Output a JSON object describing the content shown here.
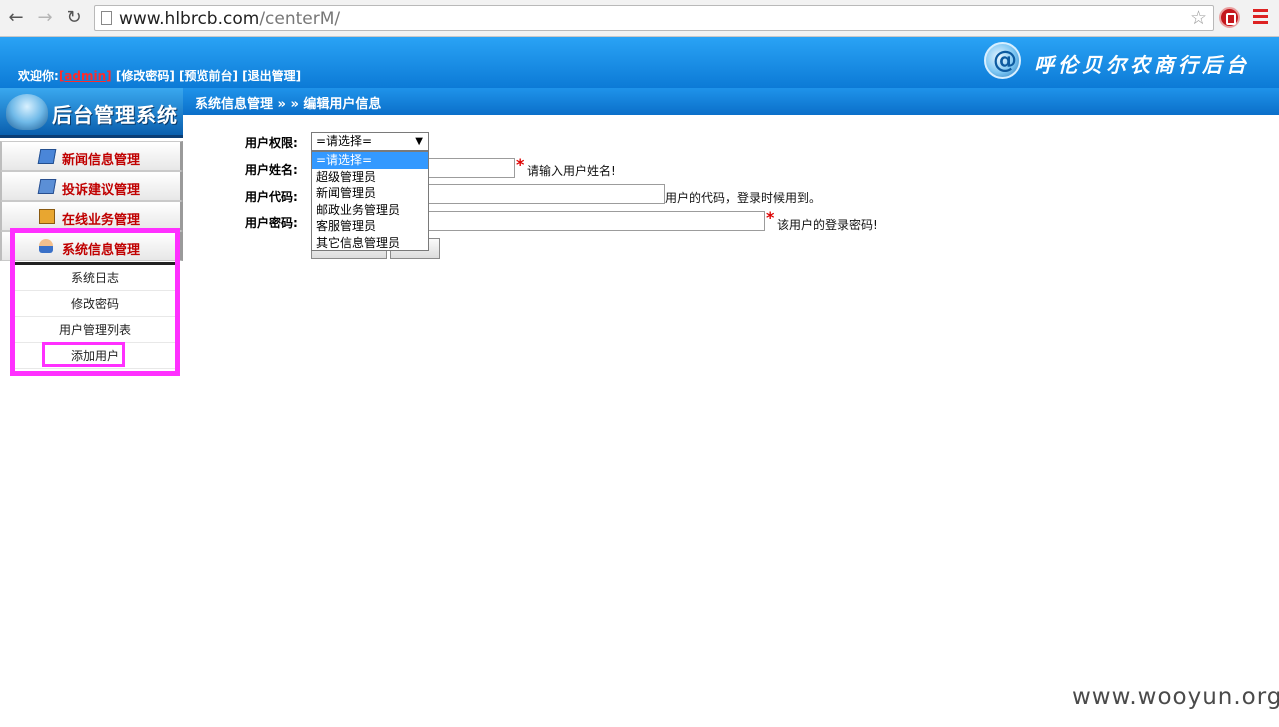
{
  "browser": {
    "url_host": "www.hlbrcb.com",
    "url_path": "/centerM/"
  },
  "header": {
    "welcome_prefix": "欢迎你:",
    "username": "[admin]",
    "change_password": "[修改密码]",
    "preview_front": "[预览前台]",
    "logout": "[退出管理]",
    "bank_name": "呼伦贝尔农商行后台"
  },
  "sidebar": {
    "logo_title": "后台管理系统",
    "items": [
      {
        "label": "新闻信息管理",
        "icon": "news-icon"
      },
      {
        "label": "投诉建议管理",
        "icon": "complaint-icon"
      },
      {
        "label": "在线业务管理",
        "icon": "online-business-icon"
      },
      {
        "label": "系统信息管理",
        "icon": "user-icon"
      }
    ],
    "sub_items": [
      {
        "label": "系统日志"
      },
      {
        "label": "修改密码"
      },
      {
        "label": "用户管理列表"
      },
      {
        "label": "添加用户"
      }
    ]
  },
  "breadcrumb": "系统信息管理 » » 编辑用户信息",
  "form": {
    "permission_label": "用户权限:",
    "permission_selected": "=请选择=",
    "permission_options": [
      "=请选择=",
      "超级管理员",
      "新闻管理员",
      "邮政业务管理员",
      "客服管理员",
      "其它信息管理员"
    ],
    "name_label": "用户姓名:",
    "name_hint": "请输入用户姓名!",
    "code_label": "用户代码:",
    "code_hint": "用户的代码，登录时候用到。",
    "password_label": "用户密码:",
    "password_hint": "该用户的登录密码!",
    "required_mark": "*"
  },
  "watermark": "www.wooyun.org",
  "colors": {
    "header_blue": "#1a8be5",
    "nav_red": "#c00000",
    "highlight_magenta": "#ff30ff",
    "selected_option": "#3399ff"
  }
}
